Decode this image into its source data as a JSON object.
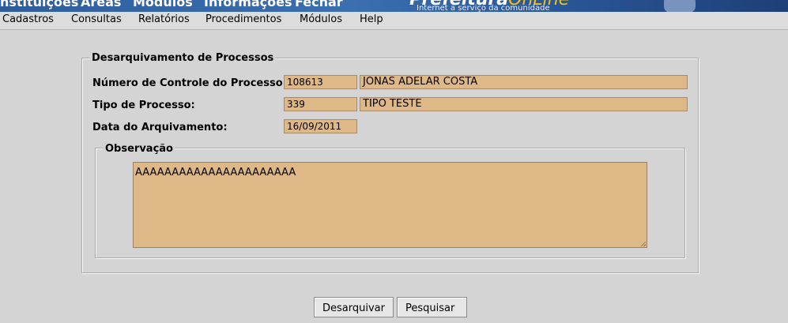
{
  "banner": {
    "nav": [
      "Instituições",
      "Áreas",
      "Módulos",
      "Informações",
      "Fechar"
    ],
    "brand_main": "Prefeitura",
    "brand_accent": "OnLine",
    "tagline": "Internet a serviço da comunidade"
  },
  "menubar": {
    "items": [
      "Cadastros",
      "Consultas",
      "Relatórios",
      "Procedimentos",
      "Módulos",
      "Help"
    ]
  },
  "form": {
    "legend": "Desarquivamento de Processos",
    "numero_label": "Número de Controle do Processo:",
    "numero_code": "108613",
    "numero_name": "JONAS ADELAR COSTA",
    "tipo_label": "Tipo de Processo:",
    "tipo_code": "339",
    "tipo_name": "TIPO TESTE",
    "data_label": "Data do Arquivamento:",
    "data_value": "16/09/2011",
    "obs_legend": "Observação",
    "obs_value": "AAAAAAAAAAAAAAAAAAAAAA"
  },
  "buttons": {
    "desarquivar": "Desarquivar",
    "pesquisar": "Pesquisar"
  },
  "colors": {
    "field_bg": "#deb887",
    "page_bg": "#d4d4d4",
    "banner_bg": "#2f5d9c",
    "brand_accent": "#f3c21a"
  }
}
